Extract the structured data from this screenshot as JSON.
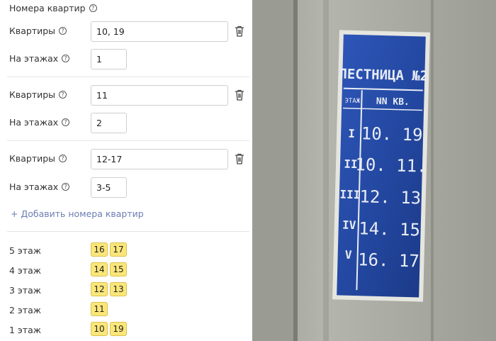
{
  "title": "Номера квартир",
  "labels": {
    "apartments": "Квартиры",
    "floors": "На этажах"
  },
  "groups": [
    {
      "apartments": "10, 19",
      "floors": "1"
    },
    {
      "apartments": "11",
      "floors": "2"
    },
    {
      "apartments": "12-17",
      "floors": "3-5"
    }
  ],
  "add_label": "+ Добавить номера квартир",
  "floor_summary": [
    {
      "label": "5 этаж",
      "apartments": [
        "16",
        "17"
      ]
    },
    {
      "label": "4 этаж",
      "apartments": [
        "14",
        "15"
      ]
    },
    {
      "label": "3 этаж",
      "apartments": [
        "12",
        "13"
      ]
    },
    {
      "label": "2 этаж",
      "apartments": [
        "11"
      ]
    },
    {
      "label": "1 этаж",
      "apartments": [
        "10",
        "19"
      ]
    }
  ],
  "sign": {
    "header": "ЛЕСТНИЦА №2",
    "col_floor": "ЭТАЖ",
    "col_apts": "NN КВ.",
    "rows": [
      {
        "floor": "I",
        "apts": "10. 19"
      },
      {
        "floor": "II",
        "apts": "10. 11."
      },
      {
        "floor": "III",
        "apts": "12. 13"
      },
      {
        "floor": "IV",
        "apts": "14. 15"
      },
      {
        "floor": "V",
        "apts": "16. 17"
      }
    ]
  }
}
